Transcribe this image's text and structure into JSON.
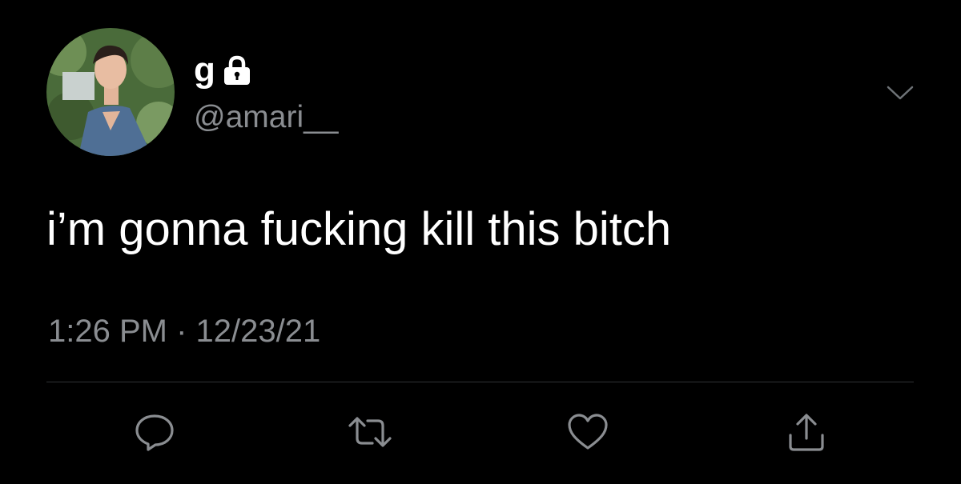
{
  "tweet": {
    "display_name": "g",
    "handle": "@amari__",
    "text": "i’m gonna fucking kill this bitch",
    "timestamp": "1:26 PM · 12/23/21"
  },
  "icons": {
    "protected": "lock-icon",
    "menu": "chevron-down-icon",
    "reply": "reply-icon",
    "retweet": "retweet-icon",
    "like": "heart-icon",
    "share": "share-icon"
  },
  "colors": {
    "background": "#000000",
    "text": "#ffffff",
    "secondary_text": "#8a8d91",
    "divider": "#2f3336",
    "icon": "#8a8d91"
  }
}
